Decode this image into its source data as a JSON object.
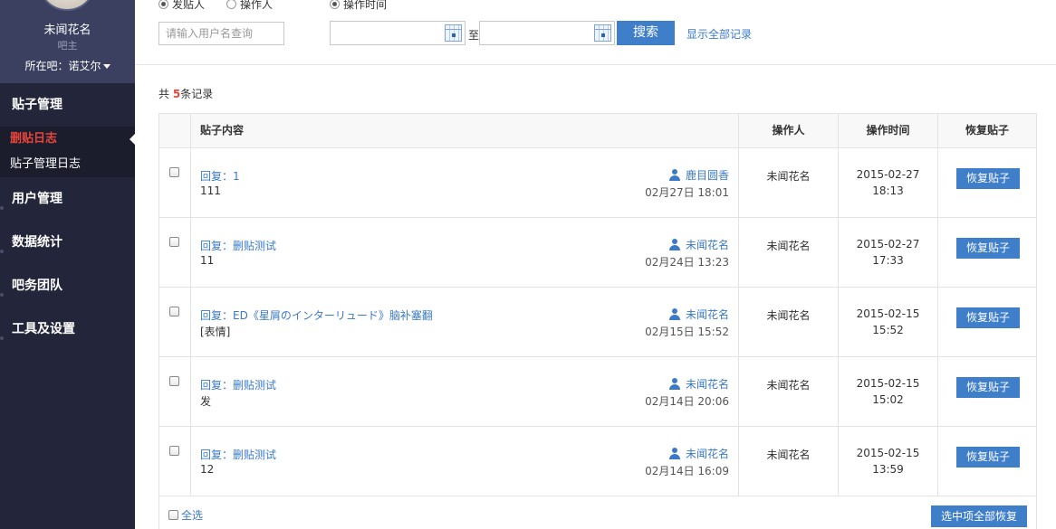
{
  "sidebar": {
    "profile": {
      "name": "未闻花名",
      "role": "吧主",
      "forum_label": "所在吧：诺艾尔"
    },
    "groups": [
      {
        "label": "贴子管理",
        "items": [
          {
            "label": "删贴日志",
            "active": true
          },
          {
            "label": "贴子管理日志",
            "active": false
          }
        ]
      },
      {
        "label": "用户管理"
      },
      {
        "label": "数据统计"
      },
      {
        "label": "吧务团队"
      },
      {
        "label": "工具及设置"
      }
    ]
  },
  "filter": {
    "radio_poster": "发贴人",
    "radio_operator": "操作人",
    "radio_time": "操作时间",
    "user_placeholder": "请输入用户名查询",
    "start_date": "",
    "end_date": "",
    "to_label": "至",
    "search_label": "搜索",
    "show_all_label": "显示全部记录"
  },
  "summary": {
    "prefix": "共 ",
    "count": "5",
    "suffix": "条记录"
  },
  "table": {
    "headers": {
      "content": "贴子内容",
      "operator": "操作人",
      "time": "操作时间",
      "restore": "恢复贴子"
    },
    "rows": [
      {
        "title": "回复：1",
        "body": "111",
        "author": "鹿目圆香",
        "post_date": "02月27日 18:01",
        "operator": "未闻花名",
        "op_date": "2015-02-27",
        "op_time": "18:13",
        "restore_label": "恢复贴子"
      },
      {
        "title": "回复：删贴测试",
        "body": "11",
        "author": "未闻花名",
        "post_date": "02月24日 13:23",
        "operator": "未闻花名",
        "op_date": "2015-02-27",
        "op_time": "17:33",
        "restore_label": "恢复贴子"
      },
      {
        "title": "回复：ED《星屑のインターリュード》脑补塞翻",
        "body": "[表情]",
        "author": "未闻花名",
        "post_date": "02月15日 15:52",
        "operator": "未闻花名",
        "op_date": "2015-02-15",
        "op_time": "15:52",
        "restore_label": "恢复贴子"
      },
      {
        "title": "回复：删贴测试",
        "body": "发",
        "author": "未闻花名",
        "post_date": "02月14日 20:06",
        "operator": "未闻花名",
        "op_date": "2015-02-15",
        "op_time": "15:02",
        "restore_label": "恢复贴子"
      },
      {
        "title": "回复：删贴测试",
        "body": "12",
        "author": "未闻花名",
        "post_date": "02月14日 16:09",
        "operator": "未闻花名",
        "op_date": "2015-02-15",
        "op_time": "13:59",
        "restore_label": "恢复贴子"
      }
    ],
    "select_all_label": "全选",
    "bulk_restore_label": "选中项全部恢复"
  },
  "colors": {
    "sidebar_bg": "#23263a",
    "profile_bg": "#3b4060",
    "accent_blue": "#3f7ec8",
    "link_blue": "#3a7ac8",
    "active_red": "#e8453c"
  }
}
